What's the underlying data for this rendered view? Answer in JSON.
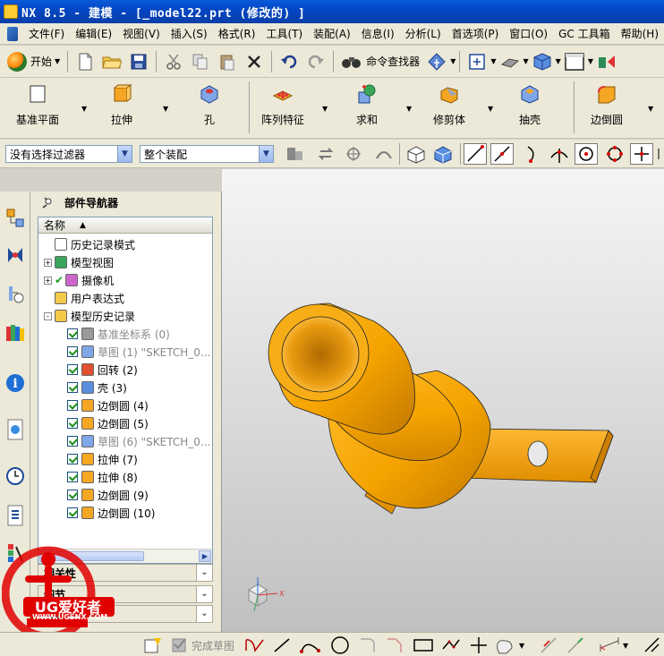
{
  "window": {
    "title": "NX 8.5 - 建模 - [_model22.prt  (修改的) ]"
  },
  "menu": {
    "items": [
      "文件(F)",
      "编辑(E)",
      "视图(V)",
      "插入(S)",
      "格式(R)",
      "工具(T)",
      "装配(A)",
      "信息(I)",
      "分析(L)",
      "首选项(P)",
      "窗口(O)",
      "GC 工具箱",
      "帮助(H)"
    ]
  },
  "standard_toolbar": {
    "start_label": "开始",
    "command_finder_label": "命令查找器"
  },
  "feature_toolbar": {
    "items": [
      {
        "label": "基准平面",
        "icon": "datum-plane-icon"
      },
      {
        "label": "拉伸",
        "icon": "extrude-icon"
      },
      {
        "label": "孔",
        "icon": "hole-icon"
      },
      {
        "label": "阵列特征",
        "icon": "pattern-feature-icon"
      },
      {
        "label": "求和",
        "icon": "unite-icon"
      },
      {
        "label": "修剪体",
        "icon": "trim-body-icon"
      },
      {
        "label": "抽壳",
        "icon": "shell-icon"
      },
      {
        "label": "边倒圆",
        "icon": "edge-blend-icon"
      }
    ]
  },
  "selection_bar": {
    "filter_value": "没有选择过滤器",
    "scope_value": "整个装配"
  },
  "navigator": {
    "title": "部件导航器",
    "column_header": "名称",
    "nodes": [
      {
        "label": "历史记录模式",
        "indent": 0,
        "expander": "",
        "icon": "clock-icon",
        "checked": false,
        "grey": false
      },
      {
        "label": "模型视图",
        "indent": 0,
        "expander": "+",
        "icon": "model-views-icon",
        "checked": false,
        "grey": false
      },
      {
        "label": "摄像机",
        "indent": 0,
        "expander": "+",
        "icon": "camera-icon",
        "checked": true,
        "grey": false
      },
      {
        "label": "用户表达式",
        "indent": 0,
        "expander": "",
        "icon": "folder-icon",
        "checked": false,
        "grey": false
      },
      {
        "label": "模型历史记录",
        "indent": 0,
        "expander": "-",
        "icon": "folder-open-icon",
        "checked": false,
        "grey": false
      },
      {
        "label": "基准坐标系 (0)",
        "indent": 1,
        "expander": "",
        "icon": "datum-csys-icon",
        "checked": true,
        "grey": true
      },
      {
        "label": "草图 (1) \"SKETCH_0...",
        "indent": 1,
        "expander": "",
        "icon": "sketch-icon",
        "checked": true,
        "grey": true
      },
      {
        "label": "回转 (2)",
        "indent": 1,
        "expander": "",
        "icon": "revolve-icon",
        "checked": true,
        "grey": false
      },
      {
        "label": "壳 (3)",
        "indent": 1,
        "expander": "",
        "icon": "shell-icon",
        "checked": true,
        "grey": false
      },
      {
        "label": "边倒圆 (4)",
        "indent": 1,
        "expander": "",
        "icon": "edge-blend-icon",
        "checked": true,
        "grey": false
      },
      {
        "label": "边倒圆 (5)",
        "indent": 1,
        "expander": "",
        "icon": "edge-blend-icon",
        "checked": true,
        "grey": false
      },
      {
        "label": "草图 (6) \"SKETCH_0...",
        "indent": 1,
        "expander": "",
        "icon": "sketch-icon",
        "checked": true,
        "grey": true
      },
      {
        "label": "拉伸 (7)",
        "indent": 1,
        "expander": "",
        "icon": "extrude-icon",
        "checked": true,
        "grey": false
      },
      {
        "label": "拉伸 (8)",
        "indent": 1,
        "expander": "",
        "icon": "extrude-icon",
        "checked": true,
        "grey": false
      },
      {
        "label": "边倒圆 (9)",
        "indent": 1,
        "expander": "",
        "icon": "edge-blend-icon",
        "checked": true,
        "grey": false
      },
      {
        "label": "边倒圆 (10)",
        "indent": 1,
        "expander": "",
        "icon": "edge-blend-icon",
        "checked": true,
        "grey": false
      }
    ],
    "panels": [
      "相关性",
      "细节",
      "预览"
    ]
  },
  "statusbar": {
    "finish_sketch_label": "完成草图"
  },
  "watermark": {
    "brand": "UG爱好者",
    "site": "WWW.UGSNX.COM"
  },
  "colors": {
    "part": "#f5a300",
    "title_blue": "#0a5bd9"
  }
}
